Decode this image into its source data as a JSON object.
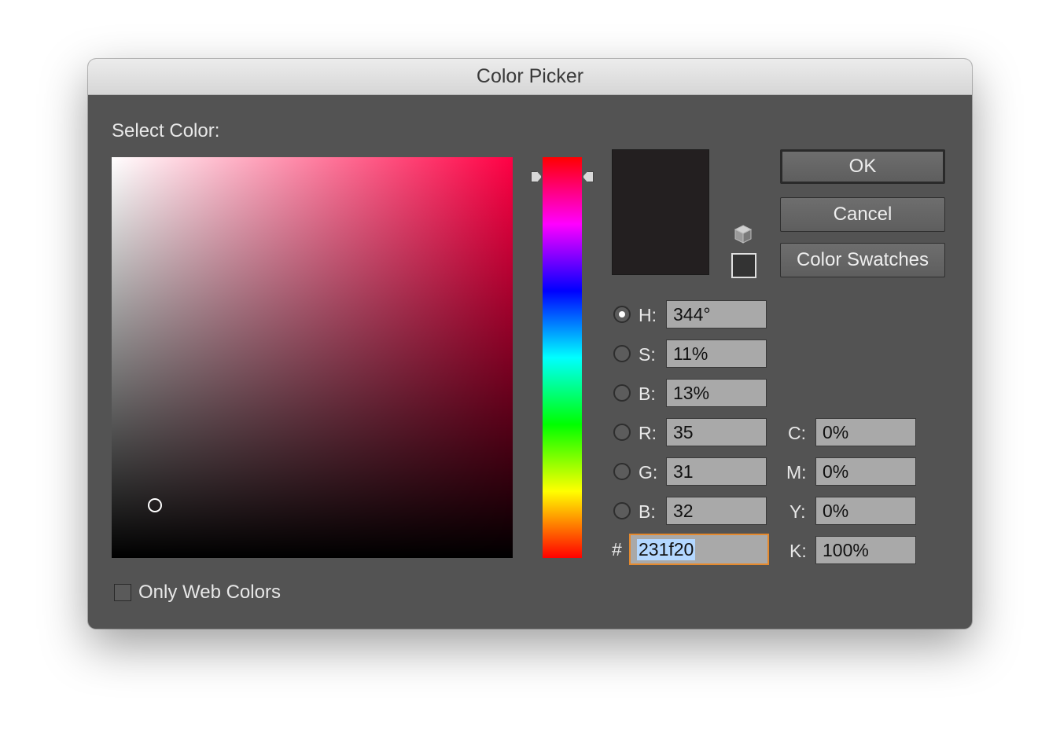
{
  "window": {
    "title": "Color Picker"
  },
  "select_color_label": "Select Color:",
  "current_color": "#231f20",
  "hue_bar_hue_deg": 344,
  "buttons": {
    "ok": "OK",
    "cancel": "Cancel",
    "swatches": "Color Swatches"
  },
  "hsb": {
    "h": {
      "label": "H:",
      "value": "344°",
      "selected": true
    },
    "s": {
      "label": "S:",
      "value": "11%"
    },
    "b": {
      "label": "B:",
      "value": "13%"
    }
  },
  "rgb": {
    "r": {
      "label": "R:",
      "value": "35"
    },
    "g": {
      "label": "G:",
      "value": "31"
    },
    "b": {
      "label": "B:",
      "value": "32"
    }
  },
  "cmyk": {
    "c": {
      "label": "C:",
      "value": "0%"
    },
    "m": {
      "label": "M:",
      "value": "0%"
    },
    "y": {
      "label": "Y:",
      "value": "0%"
    },
    "k": {
      "label": "K:",
      "value": "100%"
    }
  },
  "hex": {
    "prefix": "#",
    "value": "231f20"
  },
  "web_colors": {
    "label": "Only Web Colors",
    "checked": false
  },
  "icons": {
    "web_safe": "cube-icon"
  }
}
